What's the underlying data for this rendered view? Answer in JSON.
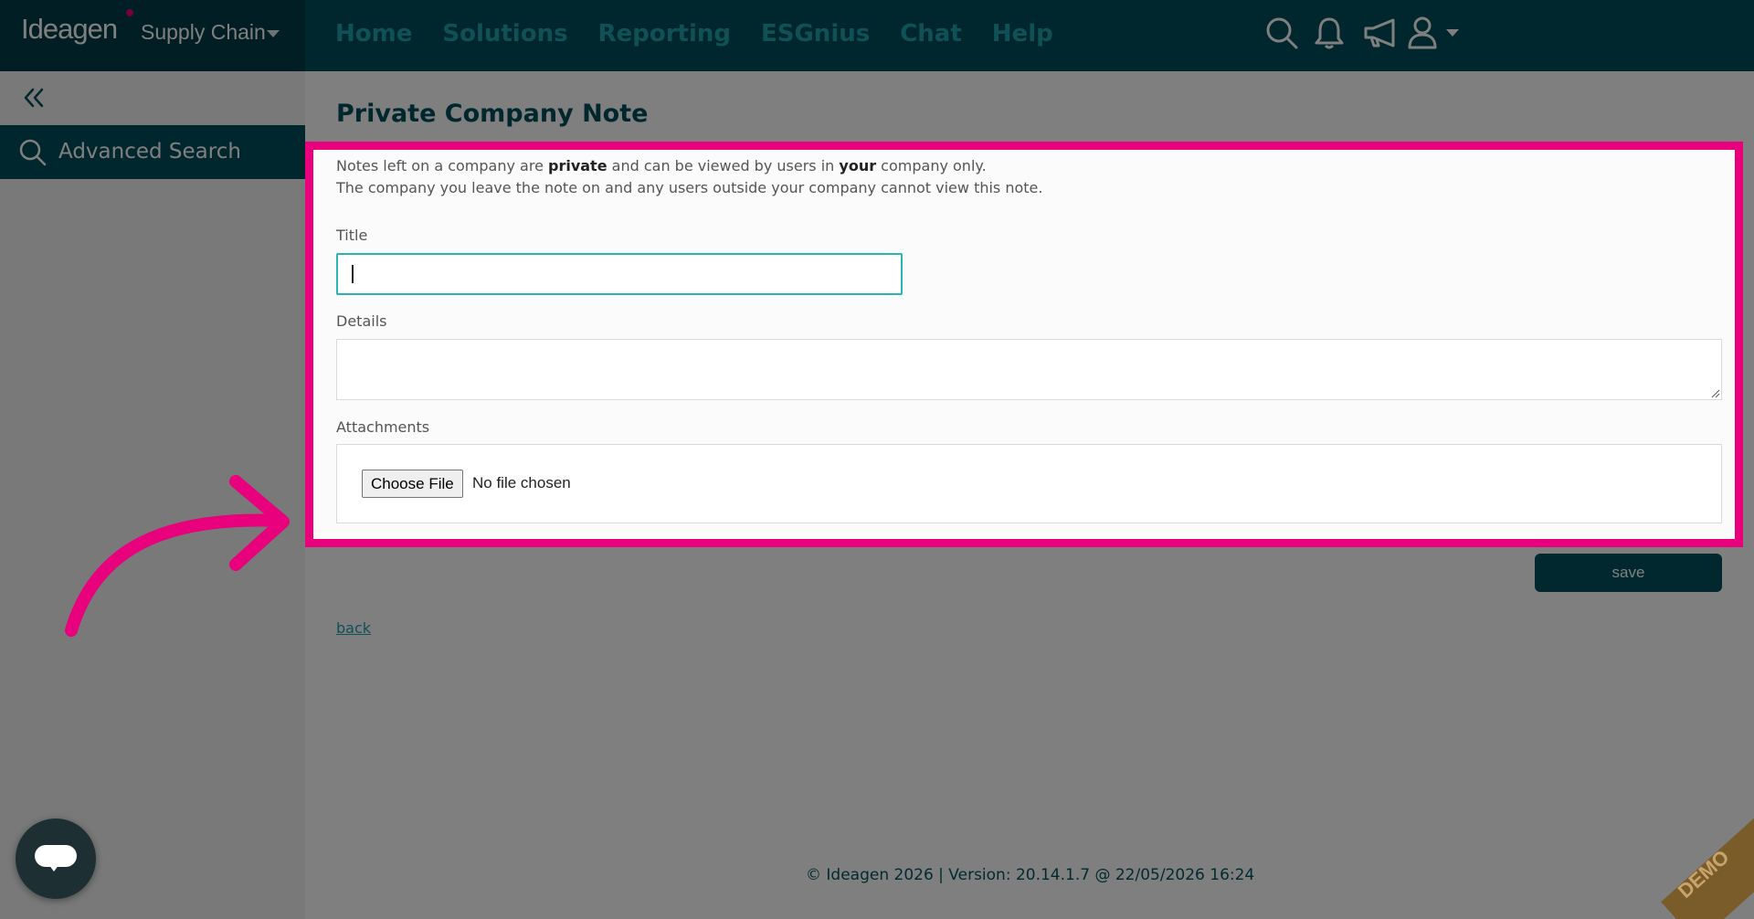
{
  "brand": {
    "logo": "Ideagen",
    "product": "Supply Chain"
  },
  "nav": [
    "Home",
    "Solutions",
    "Reporting",
    "ESGnius",
    "Chat",
    "Help"
  ],
  "top_icons": [
    "search-icon",
    "bell-icon",
    "megaphone-icon",
    "user-icon"
  ],
  "sidebar": {
    "items": [
      {
        "label": "Advanced Search",
        "icon": "search-icon"
      }
    ]
  },
  "page": {
    "title": "Private Company Note",
    "info": {
      "part1": "Notes left on a company are ",
      "bold1": "private",
      "part2": " and can be viewed by users in ",
      "bold2": "your",
      "part3": " company only.",
      "line2": "The company you leave the note on and any users outside your company cannot view this note."
    },
    "form": {
      "title_label": "Title",
      "title_value": "",
      "details_label": "Details",
      "details_value": "",
      "attachments_label": "Attachments",
      "choose_file_label": "Choose File",
      "no_file_text": "No file chosen"
    },
    "save_label": "save",
    "back_label": "back"
  },
  "footer": "© Ideagen 2026 | Version: 20.14.1.7 @ 22/05/2026 16:24",
  "demo_ribbon": "DEMO",
  "colors": {
    "primary": "#024f5c",
    "accent": "#1fa2ac",
    "highlight": "#e8007d"
  }
}
